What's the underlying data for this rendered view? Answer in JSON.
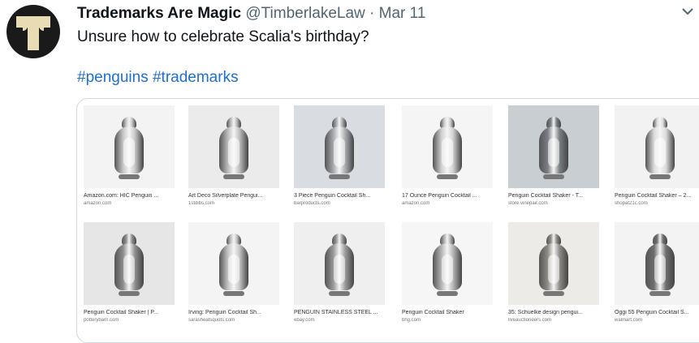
{
  "tweet": {
    "author_name": "Trademarks Are Magic",
    "handle": "@TimberlakeLaw",
    "separator": "·",
    "date": "Mar 11",
    "text": "Unsure how to celebrate Scalia's birthday?",
    "hashtags": [
      "#penguins",
      "#trademarks"
    ]
  },
  "icons": {
    "avatar": "avatar-t-logo",
    "more": "chevron-down-icon"
  },
  "results": [
    {
      "caption": "Amazon.com: HIC Penguin ...",
      "source": "amazon.com",
      "bg": "#f3f3f3",
      "metal": "#c8c8c8"
    },
    {
      "caption": "Art Deco Silverplate Pengui...",
      "source": "1stdibs.com",
      "bg": "#ebebeb",
      "metal": "#bdbdbd"
    },
    {
      "caption": "3 Piece Penguin Cocktail Sh...",
      "source": "barproducts.com",
      "bg": "#d9dde2",
      "metal": "#a9acb0"
    },
    {
      "caption": "17 Ounce Penguin Cocktail ...",
      "source": "amazon.com",
      "bg": "#f5f5f5",
      "metal": "#d0d0d0"
    },
    {
      "caption": "Penguin Cocktail Shaker - T...",
      "source": "store.vinepair.com",
      "bg": "#c9ced3",
      "metal": "#7a7f84"
    },
    {
      "caption": "Penguin Cocktail Shaker – 2...",
      "source": "shopat21c.com",
      "bg": "#f2f2f2",
      "metal": "#dcdcdc"
    },
    {
      "caption": "Penguin Cocktail Shaker | P...",
      "source": "potterybarn.com",
      "bg": "#e6e6e6",
      "metal": "#8e8e8e"
    },
    {
      "caption": "Irving: Penguin Cocktail Sh...",
      "source": "sarasheatsquots.com",
      "bg": "#f4f4f4",
      "metal": "#c4c4c4"
    },
    {
      "caption": "PENGUIN STAINLESS STEEL ...",
      "source": "ebay.com",
      "bg": "#efefef",
      "metal": "#9a9a9a"
    },
    {
      "caption": "Penguin Cocktail Shaker",
      "source": "bhg.com",
      "bg": "#f6f6f6",
      "metal": "#b5b5b5"
    },
    {
      "caption": "35: Schuelke design pengui...",
      "source": "liveauctioneers.com",
      "bg": "#ecebe8",
      "metal": "#8f8c86"
    },
    {
      "caption": "Oggi 55 Penguin Cocktail S...",
      "source": "walmart.com",
      "bg": "#f3f3f3",
      "metal": "#6f6f6f"
    }
  ]
}
